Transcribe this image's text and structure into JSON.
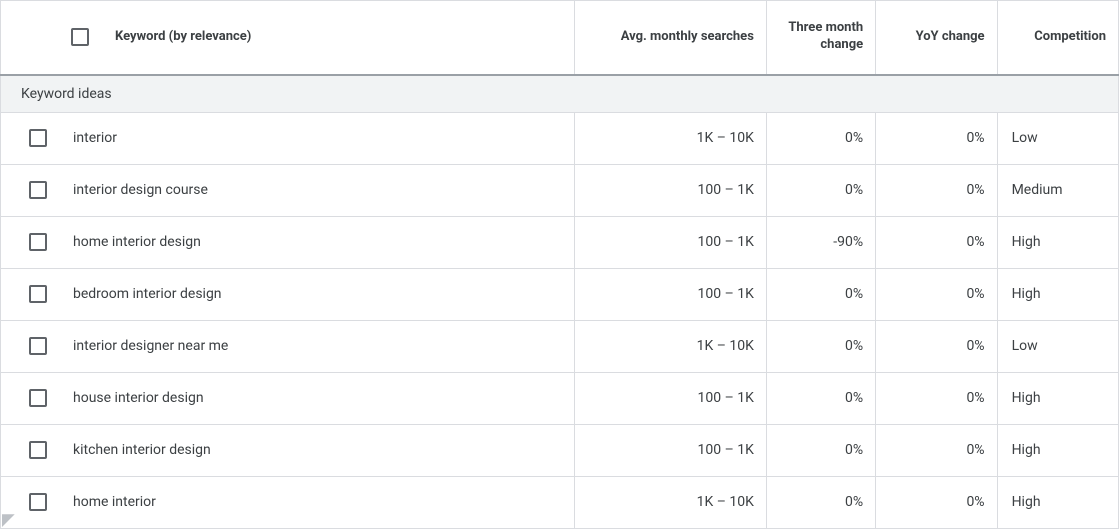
{
  "columns": {
    "keyword": "Keyword (by relevance)",
    "avg": "Avg. monthly searches",
    "three_month": "Three month change",
    "yoy": "YoY change",
    "competition": "Competition"
  },
  "section_label": "Keyword ideas",
  "rows": [
    {
      "keyword": "interior",
      "avg": "1K – 10K",
      "three_month": "0%",
      "yoy": "0%",
      "competition": "Low"
    },
    {
      "keyword": "interior design course",
      "avg": "100 – 1K",
      "three_month": "0%",
      "yoy": "0%",
      "competition": "Medium"
    },
    {
      "keyword": "home interior design",
      "avg": "100 – 1K",
      "three_month": "-90%",
      "yoy": "0%",
      "competition": "High"
    },
    {
      "keyword": "bedroom interior design",
      "avg": "100 – 1K",
      "three_month": "0%",
      "yoy": "0%",
      "competition": "High"
    },
    {
      "keyword": "interior designer near me",
      "avg": "1K – 10K",
      "three_month": "0%",
      "yoy": "0%",
      "competition": "Low"
    },
    {
      "keyword": "house interior design",
      "avg": "100 – 1K",
      "three_month": "0%",
      "yoy": "0%",
      "competition": "High"
    },
    {
      "keyword": "kitchen interior design",
      "avg": "100 – 1K",
      "three_month": "0%",
      "yoy": "0%",
      "competition": "High"
    },
    {
      "keyword": "home interior",
      "avg": "1K – 10K",
      "three_month": "0%",
      "yoy": "0%",
      "competition": "High"
    }
  ]
}
